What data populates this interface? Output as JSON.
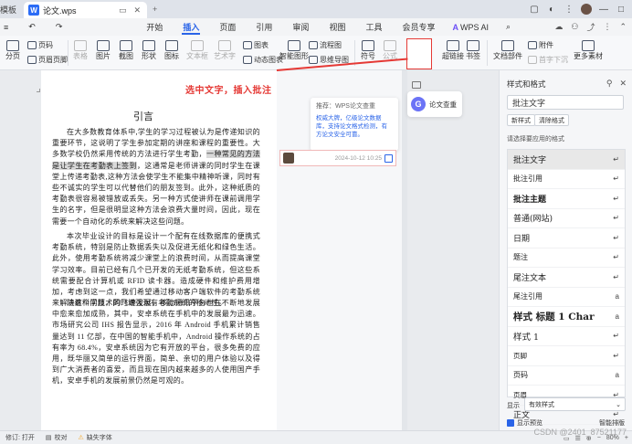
{
  "titlebar": {
    "prev_tab": "模板",
    "active_tab": "论文.wps",
    "logo": "W"
  },
  "menubar": {
    "items": [
      "开始",
      "插入",
      "页面",
      "引用",
      "审阅",
      "视图",
      "工具",
      "会员专享"
    ],
    "active_index": 1,
    "ai_label": "WPS AI"
  },
  "ribbon": {
    "page": "分页",
    "blank_page": "页码",
    "header_footer": "页眉页脚",
    "form": "表格",
    "picture": "图片",
    "screenshot": "截图",
    "shape": "形状",
    "icon": "图标",
    "textbox": "文本框",
    "wordart": "艺术字",
    "chart": "图表",
    "dynamic_chart": "动态图表",
    "flowchart": "流程图",
    "smart_shape": "智能图形",
    "mindmap": "思维导图",
    "symbol": "符号",
    "formula": "公式",
    "comment": "批注",
    "hyperlink": "超链接",
    "bookmark": "书签",
    "doc_part": "文档部件",
    "attachment": "附件",
    "date": "日期",
    "first_letter": "首字下沉",
    "more": "更多素材",
    "accent": "#2a64e8"
  },
  "annotation": {
    "text": "选中文字，插入批注",
    "color": "#e53935"
  },
  "document": {
    "title": "引言",
    "paragraphs": [
      {
        "before": "在大多数教育体系中,学生的学习过程被认为是传递知识的重要环节，这说明了学生参加定期的讲座和课程的重要性。大多数学校仍然采用传统的方法进行学生考勤，",
        "highlight": "一种常见的方法是让学生在考勤表上签到",
        "after": "，这通常是老师讲课的同时学生在课堂上传递考勤表,这种方法会使学生不能集中精神听课，同时有些不诚实的学生可以代替他们的朋友签到。此外，这种纸质的考勤表很容易被错放或丢失。另一种方式使讲师在课前调用学生的名字，但是很明显这种方法会浪费大量时间，因此，现在需要一个自动化的系统来解决这些问题。"
      },
      {
        "text": "本次毕业设计的目标是设计一个配有在线数据库的便携式考勤系统，特别是防止数据丢失以及促进无纸化和绿色生活。此外，使用考勤系统将减少课堂上的浪费时间，从而提高课堂学习效率。目前已经有几个已开发的无纸考勤系统，但这些系统需要配合计算机或 RFID 读卡器。造成硬件和维护费用增加，考虑到这一点，我们希望通过移动客户端软件的考勤系统来解决这个问题，同时增强现有考勤系统的移动性。"
      },
      {
        "text": "随着科学技术的飞速发展，移动通讯平台也在不断地发展中愈来愈加成熟，其中，安卓系统在手机中的发展最为迅速。市场研究公司 IHS 报告显示，2016 年 Android 手机累计销售量达到 11 亿部，在中国的智能手机中，Android 操作系统的占有率为 68.4%，安卓系统因为它有开放的平台，很多免费的应用，既华丽又简单的运行界面，简单、亲切的用户体验以及得到广大消费者的喜爱，而且现在国内越来越多的人使用国产手机，安卓手机的发展前景仍然是可观的。"
      }
    ]
  },
  "comment": {
    "time": "2024-10-12 10:25",
    "tip_title": "推荐：WPS论文查重",
    "tip_body": "权威大牌，亿级论文数据库，支持论文格式检测，有方论文安全可靠。"
  },
  "float_card": {
    "label": "论文查重",
    "icon_letter": "G"
  },
  "styles_panel": {
    "title": "样式和格式",
    "current": "批注文字",
    "new_style": "新样式",
    "clear_format": "清除格式",
    "hint": "请选择要应用的格式",
    "items": [
      {
        "name": "批注文字",
        "mark": "↵",
        "selected": true
      },
      {
        "name": "批注引用",
        "mark": "↵"
      },
      {
        "name": "批注主题",
        "mark": "↵"
      },
      {
        "name": "普通(网站)",
        "mark": "↵"
      },
      {
        "name": "日期",
        "mark": "↵"
      },
      {
        "name": "题注",
        "mark": "↵"
      },
      {
        "name": "尾注文本",
        "mark": "↵"
      },
      {
        "name": "尾注引用",
        "mark": "a"
      },
      {
        "name": "样式 标题 1 Char",
        "mark": "a"
      },
      {
        "name": "样式 1",
        "mark": "↵"
      },
      {
        "name": "页脚",
        "mark": "↵"
      },
      {
        "name": "页码",
        "mark": "a"
      },
      {
        "name": "页眉",
        "mark": "↵"
      },
      {
        "name": "正文",
        "mark": "↵"
      }
    ],
    "show_label": "显示",
    "show_value": "有效样式",
    "preview": "显示预览",
    "smart": "智能排版"
  },
  "statusbar": {
    "revision": "修订: 打开",
    "proof": "校对",
    "missing_font": "缺失字体",
    "zoom": "80%"
  },
  "watermark": "CSDN @2401_87521177"
}
